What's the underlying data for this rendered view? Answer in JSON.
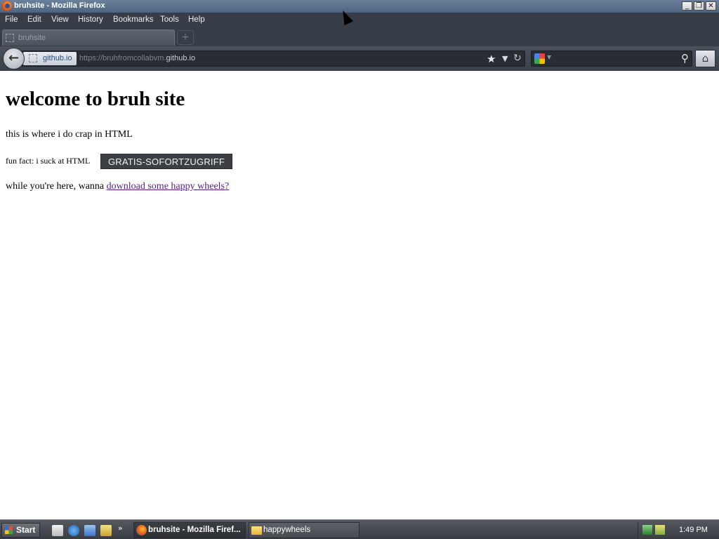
{
  "window": {
    "title": "bruhsite - Mozilla Firefox",
    "controls": {
      "minimize": "_",
      "maximize": "❐",
      "close": "✕"
    }
  },
  "menu": {
    "items": [
      {
        "label": "File"
      },
      {
        "label": "Edit"
      },
      {
        "label": "View"
      },
      {
        "label": "History"
      },
      {
        "label": "Bookmarks"
      },
      {
        "label": "Tools"
      },
      {
        "label": "Help"
      }
    ]
  },
  "tabs": {
    "active_tab_label": "bruhsite",
    "new_tab_icon": "plus-icon"
  },
  "navbar": {
    "identity_label": "github.io",
    "url_prefix": "https://bruhfromcollabvm.",
    "url_host": "github.io",
    "search_value": "",
    "icons": {
      "back": "back-arrow-icon",
      "bookmark": "star-icon",
      "history": "dropdown-icon",
      "reload": "reload-icon",
      "search_engine": "google-icon",
      "search": "magnifier-icon",
      "home": "home-icon"
    }
  },
  "page": {
    "heading": "welcome to bruh site",
    "intro": "this is where i do crap in HTML",
    "fun_fact": "fun fact: i suck at HTML",
    "ad_button": "GRATIS-SOFORTZUGRIFF",
    "download_prefix": "while you're here, wanna ",
    "download_link": "download some happy wheels?"
  },
  "taskbar": {
    "start_label": "Start",
    "quick_launch_more": "»",
    "tasks": [
      {
        "label": "bruhsite - Mozilla Firef...",
        "icon": "firefox-icon",
        "active": true
      },
      {
        "label": "happywheels",
        "icon": "folder-icon",
        "active": false
      }
    ],
    "clock": "1:49 PM"
  },
  "colors": {
    "menubar_bg": "#373d47",
    "titlebar_bg": "#4d6480",
    "visited_link": "#551a8b",
    "ad_button_bg": "#3c3f44"
  }
}
